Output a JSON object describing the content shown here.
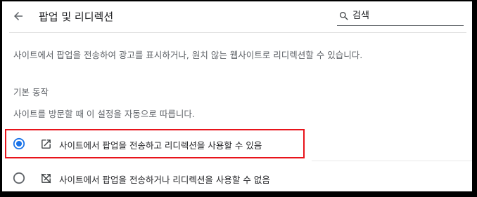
{
  "header": {
    "title": "팝업 및 리디렉션",
    "search_placeholder": "검색"
  },
  "main": {
    "description": "사이트에서 팝업을 전송하여 광고를 표시하거나, 원치 않는 웹사이트로 리디렉션할 수 있습니다.",
    "section_title": "기본 동작",
    "section_description": "사이트를 방문할 때 이 설정을 자동으로 따릅니다.",
    "options": [
      {
        "label": "사이트에서 팝업을 전송하고 리디렉션을 사용할 수 있음",
        "selected": true,
        "icon": "open-in-new-icon"
      },
      {
        "label": "사이트에서 팝업을 전송하거나 리디렉션을 사용할 수 없음",
        "selected": false,
        "icon": "open-in-new-off-icon"
      }
    ]
  },
  "colors": {
    "accent": "#1a73e8",
    "highlight_box": "#e8141b",
    "secondary_text": "#5f6368",
    "primary_text": "#202124"
  }
}
